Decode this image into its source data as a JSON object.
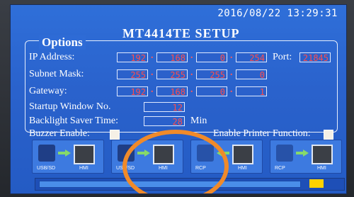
{
  "datetime": "2016/08/22 13:29:31",
  "title": "MT4414TE SETUP",
  "options": {
    "label": "Options",
    "ip_label": "IP Address:",
    "ip": [
      "192",
      "168",
      "0",
      "254"
    ],
    "port_label": "Port:",
    "port": "21845",
    "subnet_label": "Subnet Mask:",
    "subnet": [
      "255",
      "255",
      "255",
      "0"
    ],
    "gateway_label": "Gateway:",
    "gateway": [
      "192",
      "168",
      "0",
      "1"
    ],
    "startup_label": "Startup Window No.",
    "startup": "12",
    "backlight_label": "Backlight Saver Time:",
    "backlight": "28",
    "backlight_unit": "Min",
    "buzzer_label": "Buzzer Enable:",
    "printer_label": "Enable Printer Function:"
  },
  "modes": [
    {
      "left": "USB/SD",
      "right": "HMI"
    },
    {
      "left": "USB/SD",
      "right": "HMI"
    },
    {
      "left": "RCP",
      "right": "HMI"
    },
    {
      "left": "RCP",
      "right": "HMI"
    }
  ],
  "colors": {
    "screen": "#2f6fd9",
    "field_text": "#ff5a5a",
    "highlight": "#f08a2a"
  }
}
